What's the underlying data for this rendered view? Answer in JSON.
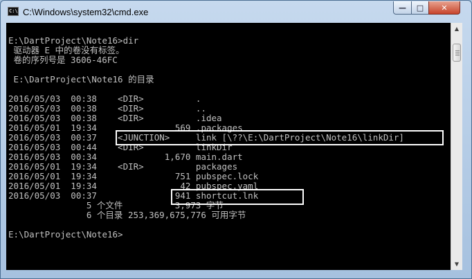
{
  "window": {
    "title": "C:\\Windows\\system32\\cmd.exe",
    "icon": "cmd-icon",
    "buttons": {
      "minimize": "—",
      "maximize": "□",
      "close": "✕"
    }
  },
  "console": {
    "lines": [
      "E:\\DartProject\\Note16>dir",
      " 驱动器 E 中的卷没有标签。",
      " 卷的序列号是 3606-46FC",
      "",
      " E:\\DartProject\\Note16 的目录",
      "",
      "2016/05/03  00:38    <DIR>          .",
      "2016/05/03  00:38    <DIR>          ..",
      "2016/05/03  00:38    <DIR>          .idea",
      "2016/05/01  19:34               569 .packages",
      "2016/05/03  00:37    <JUNCTION>     link [\\??\\E:\\DartProject\\Note16\\linkDir]",
      "2016/05/03  00:44    <DIR>          linkDir",
      "2016/05/03  00:34             1,670 main.dart",
      "2016/05/01  19:34    <DIR>          packages",
      "2016/05/01  19:34               751 pubspec.lock",
      "2016/05/01  19:34                42 pubspec.yaml",
      "2016/05/03  00:37               941 shortcut.lnk",
      "               5 个文件          3,973 字节",
      "               6 个目录 253,369,675,776 可用字节",
      "",
      "E:\\DartProject\\Note16>"
    ]
  },
  "scrollbar": {
    "up": "▲",
    "down": "▼"
  }
}
